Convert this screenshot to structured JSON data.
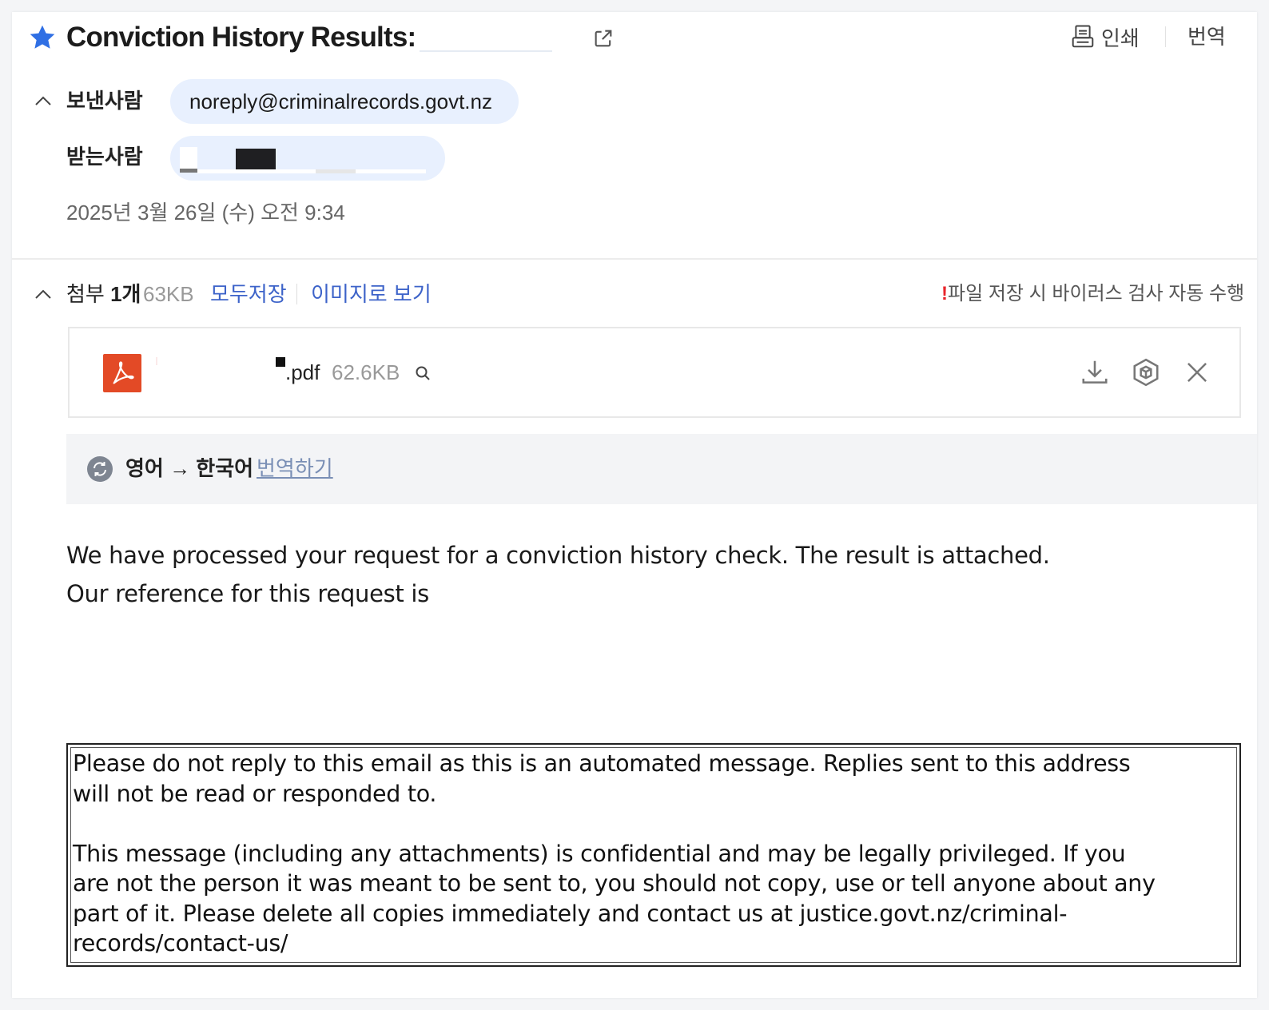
{
  "header": {
    "subject": "Conviction History Results:",
    "print_label": "인쇄",
    "translate_label": "번역"
  },
  "sender": {
    "label": "보낸사람",
    "email": "noreply@criminalrecords.govt.nz"
  },
  "recipient": {
    "label": "받는사람"
  },
  "date": "2025년 3월 26일 (수) 오전 9:34",
  "attachments": {
    "title_prefix": "첨부 ",
    "count": "1개",
    "total_size": "63KB",
    "save_all": "모두저장",
    "view_as_image": "이미지로 보기",
    "warning_mark": "!",
    "warning": "파일 저장 시 바이러스 검사 자동 수행",
    "items": [
      {
        "name": ".pdf",
        "size": "62.6KB"
      }
    ]
  },
  "translate_bar": {
    "languages": "영어 → 한국어",
    "action": "번역하기"
  },
  "body": {
    "line1": "We have processed your request for a conviction history check. The result is attached.",
    "line2": "Our reference for this request is"
  },
  "disclaimer": {
    "p1_l1": "Please do not reply to this email as this is an automated message. Replies sent to this address",
    "p1_l2": "will not be read or responded to.",
    "p2_l1": "This message (including any attachments) is confidential and may be legally privileged. If you",
    "p2_l2": "are not the person it was meant to be sent to, you should not copy, use or tell anyone about any",
    "p2_l3": "part of it. Please delete all copies immediately and contact us at justice.govt.nz/criminal-",
    "p2_l4": "records/contact-us/"
  },
  "colors": {
    "accent_blue": "#2f6fe4",
    "chip_bg": "#e8f0fe",
    "link_blue": "#3d63c9",
    "warning_red": "#e8252b",
    "pdf_red": "#e34a26"
  },
  "icons": [
    "star-icon",
    "popout-icon",
    "print-icon",
    "chevron-up-icon",
    "pdf-icon",
    "search-icon",
    "download-icon",
    "cube-icon",
    "close-icon",
    "translate-icon"
  ]
}
